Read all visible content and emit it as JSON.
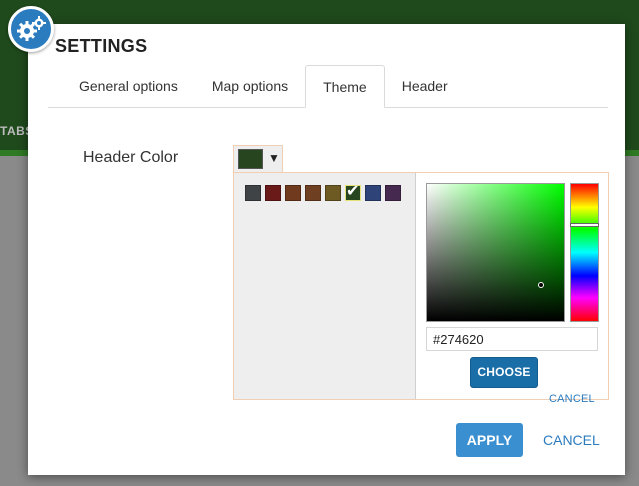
{
  "background": {
    "tabs_label": "TABS",
    "header_color": "#1f4a1c",
    "accent_green": "#2f7a24"
  },
  "dialog": {
    "title": "SETTINGS",
    "icon": "gears-icon",
    "tabs": [
      {
        "label": "General options",
        "active": false
      },
      {
        "label": "Map options",
        "active": false
      },
      {
        "label": "Theme",
        "active": true
      },
      {
        "label": "Header",
        "active": false
      }
    ],
    "field": {
      "label": "Header Color",
      "current_color": "#274620"
    },
    "color_picker": {
      "palette": [
        "#3f4346",
        "#6b1a1a",
        "#6f3a1d",
        "#6e3f20",
        "#6d5a22",
        "#274620",
        "#2e4377",
        "#46294f"
      ],
      "selected_index": 5,
      "hex_value": "#274620",
      "hue_level_fraction": 0.29,
      "saturation": 0.82,
      "value": 0.27,
      "choose_label": "CHOOSE",
      "cancel_label": "CANCEL"
    },
    "apply_label": "APPLY",
    "cancel_label": "CANCEL"
  }
}
